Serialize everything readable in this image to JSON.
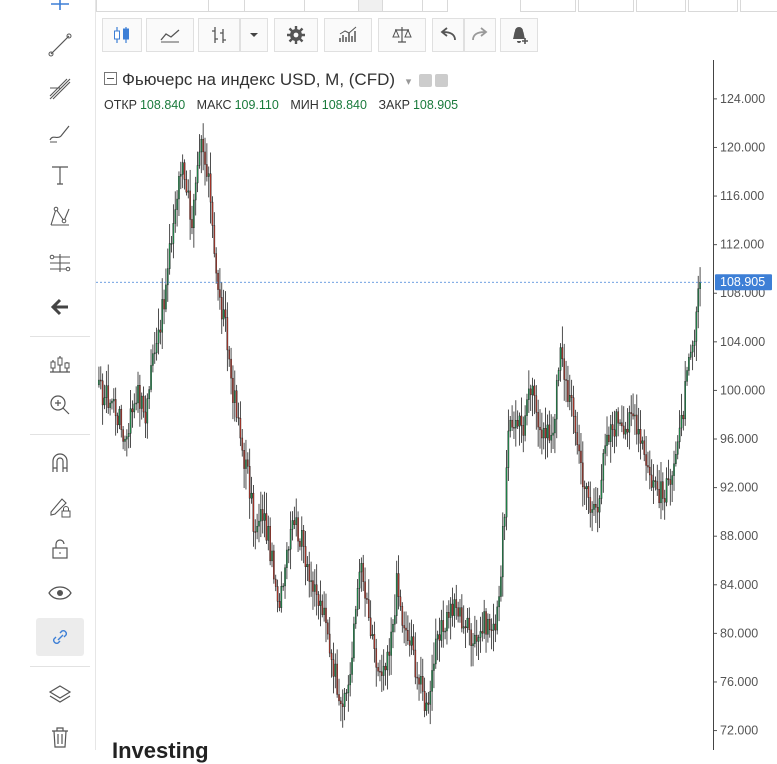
{
  "legend": {
    "title": "Фьючерс на индекс USD, М, (CFD)",
    "open_label": "ОТКР",
    "open": "108.840",
    "high_label": "МАКС",
    "high": "109.110",
    "low_label": "МИН",
    "low": "108.840",
    "close_label": "ЗАКР",
    "close": "108.905"
  },
  "watermark": "Investing",
  "colors": {
    "up": "#1f9a52",
    "down": "#c0392b",
    "wick": "#222222",
    "price_tag": "#3d7fd6",
    "price_line": "#3d7fd6"
  },
  "icons": {
    "left_toolbar": [
      "cross-icon",
      "trendline-icon",
      "fib-icon",
      "brush-icon",
      "text-icon",
      "pattern-icon",
      "prediction-icon",
      "back-arrow-icon",
      "measure-icon",
      "zoom-in-icon",
      "magnet-icon",
      "lock-pencil-icon",
      "unlock-icon",
      "eye-icon",
      "link-icon",
      "layers-icon",
      "trash-icon"
    ],
    "top_toolbar": [
      "candles-icon",
      "area-icon",
      "bars-icon",
      "dropdown-icon",
      "settings-icon",
      "indicators-icon",
      "compare-icon",
      "undo-icon",
      "redo-icon",
      "alert-icon"
    ]
  },
  "chart_data": {
    "type": "candlestick",
    "title": "Фьючерс на индекс USD, М, (CFD)",
    "ylim": [
      70.4,
      127.2
    ],
    "y_ticks": [
      "124.000",
      "120.000",
      "116.000",
      "112.000",
      "108.000",
      "104.000",
      "100.000",
      "96.000",
      "92.000",
      "88.000",
      "84.000",
      "80.000",
      "76.000",
      "72.000"
    ],
    "last_price": "108.905",
    "anchors": [
      [
        0,
        100
      ],
      [
        8,
        99
      ],
      [
        14,
        96
      ],
      [
        20,
        100
      ],
      [
        25,
        98
      ],
      [
        30,
        104
      ],
      [
        35,
        107
      ],
      [
        40,
        114
      ],
      [
        45,
        119
      ],
      [
        50,
        114
      ],
      [
        55,
        120
      ],
      [
        60,
        116
      ],
      [
        64,
        108
      ],
      [
        68,
        105
      ],
      [
        72,
        100
      ],
      [
        76,
        96
      ],
      [
        80,
        93
      ],
      [
        84,
        88
      ],
      [
        88,
        90
      ],
      [
        92,
        87
      ],
      [
        96,
        82
      ],
      [
        100,
        86
      ],
      [
        104,
        90
      ],
      [
        108,
        88
      ],
      [
        112,
        86
      ],
      [
        116,
        83
      ],
      [
        120,
        82
      ],
      [
        124,
        79
      ],
      [
        128,
        76
      ],
      [
        132,
        74
      ],
      [
        136,
        78
      ],
      [
        140,
        86
      ],
      [
        144,
        82
      ],
      [
        148,
        78
      ],
      [
        152,
        76
      ],
      [
        156,
        78
      ],
      [
        160,
        84
      ],
      [
        164,
        80
      ],
      [
        168,
        79
      ],
      [
        172,
        76
      ],
      [
        176,
        74
      ],
      [
        180,
        78
      ],
      [
        184,
        80
      ],
      [
        188,
        82
      ],
      [
        192,
        82
      ],
      [
        196,
        81
      ],
      [
        200,
        80
      ],
      [
        204,
        80
      ],
      [
        208,
        81
      ],
      [
        212,
        80
      ],
      [
        216,
        85
      ],
      [
        220,
        96
      ],
      [
        224,
        98
      ],
      [
        228,
        97
      ],
      [
        232,
        100
      ],
      [
        236,
        98
      ],
      [
        240,
        96
      ],
      [
        244,
        97
      ],
      [
        248,
        103
      ],
      [
        252,
        100
      ],
      [
        256,
        97
      ],
      [
        260,
        93
      ],
      [
        264,
        90
      ],
      [
        268,
        91
      ],
      [
        272,
        95
      ],
      [
        276,
        97
      ],
      [
        280,
        98
      ],
      [
        284,
        97
      ],
      [
        288,
        98
      ],
      [
        292,
        96
      ],
      [
        296,
        93
      ],
      [
        300,
        92
      ],
      [
        304,
        91
      ],
      [
        308,
        94
      ],
      [
        312,
        96
      ],
      [
        316,
        101
      ],
      [
        320,
        104
      ],
      [
        323,
        109
      ]
    ]
  }
}
